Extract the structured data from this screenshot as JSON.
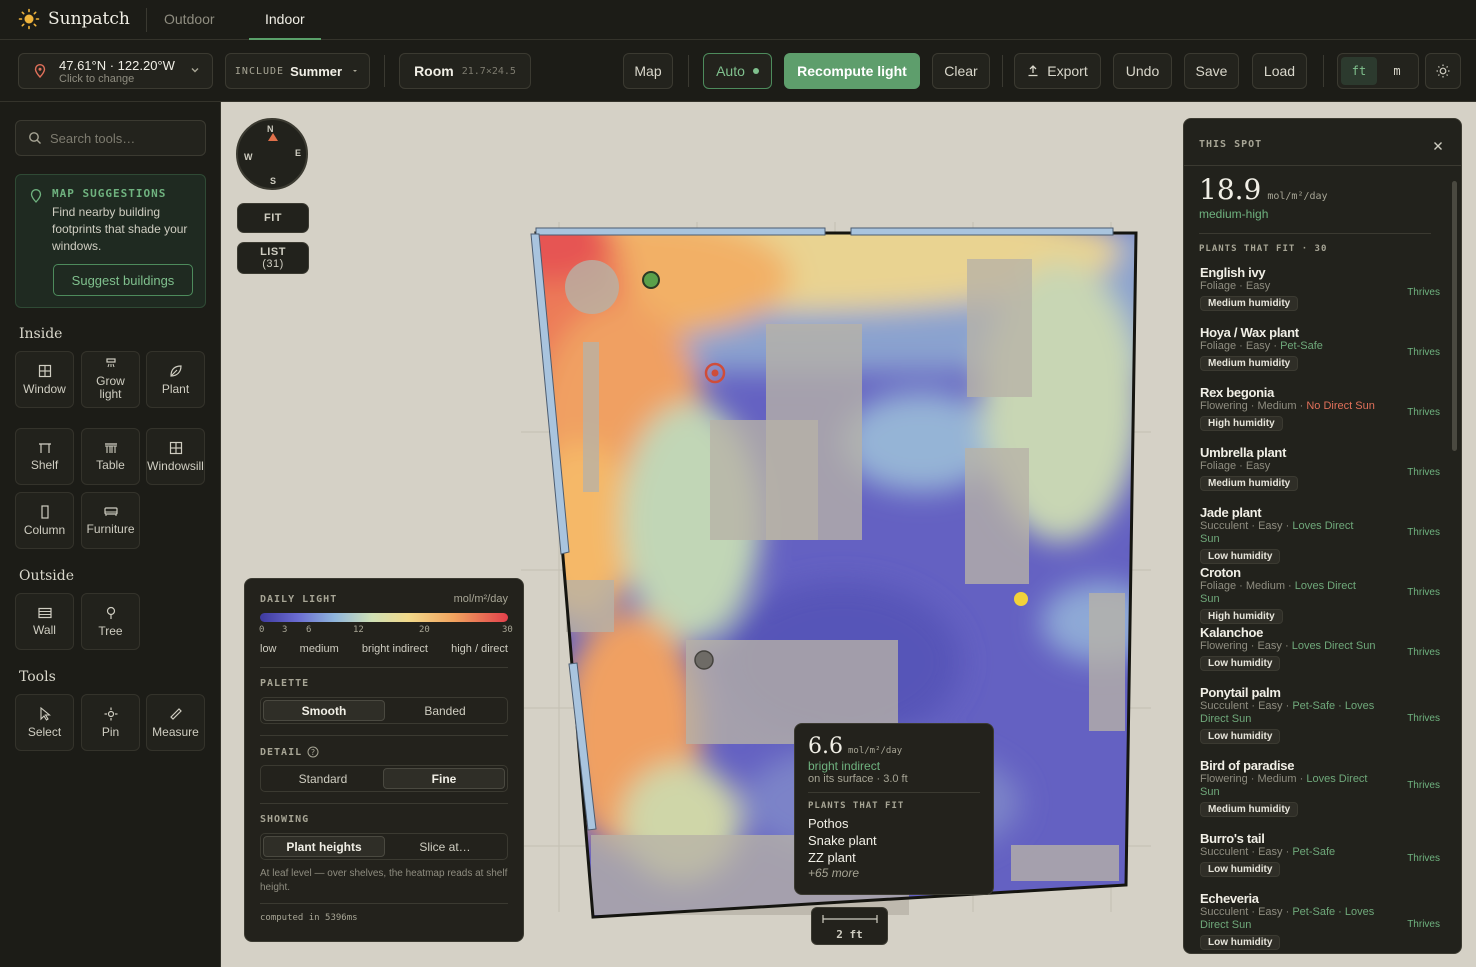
{
  "app": {
    "name": "Sunpatch"
  },
  "tabs": [
    {
      "label": "Outdoor"
    },
    {
      "label": "Indoor"
    }
  ],
  "toolbar": {
    "location_coords": "47.61°N · 122.20°W",
    "location_hint": "Click to change",
    "include_label": "INCLUDE",
    "season": "Summer",
    "room_label": "Room",
    "room_dims": "21.7×24.5",
    "map": "Map",
    "auto": "Auto",
    "recompute": "Recompute light",
    "clear": "Clear",
    "export": "Export",
    "undo": "Undo",
    "save": "Save",
    "load": "Load",
    "unit_ft": "ft",
    "unit_m": "m"
  },
  "sidebar": {
    "search_placeholder": "Search tools…",
    "suggest_title": "MAP SUGGESTIONS",
    "suggest_body": "Find nearby building footprints that shade your windows.",
    "suggest_button": "Suggest buildings",
    "sections": {
      "inside": "Inside",
      "outside": "Outside",
      "tools": "Tools"
    },
    "inside_tools": [
      {
        "label": "Window",
        "icon": "window-icon"
      },
      {
        "label": "Grow light",
        "icon": "grow-light-icon"
      },
      {
        "label": "Plant",
        "icon": "leaf-icon"
      },
      {
        "label": "Shelf",
        "icon": "shelf-icon"
      },
      {
        "label": "Table",
        "icon": "table-icon"
      },
      {
        "label": "Windowsill",
        "icon": "windowsill-icon"
      },
      {
        "label": "Column",
        "icon": "column-icon"
      },
      {
        "label": "Furniture",
        "icon": "sofa-icon"
      }
    ],
    "outside_tools": [
      {
        "label": "Wall",
        "icon": "wall-icon"
      },
      {
        "label": "Tree",
        "icon": "tree-icon"
      }
    ],
    "tools": [
      {
        "label": "Select",
        "icon": "cursor-icon"
      },
      {
        "label": "Pin",
        "icon": "pin-icon"
      },
      {
        "label": "Measure",
        "icon": "ruler-icon"
      }
    ]
  },
  "canvas": {
    "compass": {
      "n": "N",
      "e": "E",
      "s": "S",
      "w": "W"
    },
    "fit": "FIT",
    "list": "LIST",
    "list_count": "(31)"
  },
  "legend": {
    "title": "DAILY LIGHT",
    "unit": "mol/m²/day",
    "ticks": [
      "0",
      "3",
      "6",
      "12",
      "20",
      "30"
    ],
    "bands": [
      "low",
      "medium",
      "bright indirect",
      "high / direct"
    ],
    "palette_title": "PALETTE",
    "palette_options": [
      "Smooth",
      "Banded"
    ],
    "palette_selected": "Smooth",
    "detail_title": "DETAIL",
    "detail_options": [
      "Standard",
      "Fine"
    ],
    "detail_selected": "Fine",
    "showing_title": "SHOWING",
    "showing_options": [
      "Plant heights",
      "Slice at…"
    ],
    "showing_selected": "Plant heights",
    "showing_note": "At leaf level — over shelves, the heatmap reads at shelf height.",
    "computed": "computed in 5396ms"
  },
  "tooltip": {
    "value": "6.6",
    "unit": "mol/m²/day",
    "band": "bright indirect",
    "surface": "on its surface · 3.0 ft",
    "plants_title": "PLANTS THAT FIT",
    "plants": [
      "Pothos",
      "Snake plant",
      "ZZ plant"
    ],
    "more": "+65 more"
  },
  "scale": {
    "label": "2 ft"
  },
  "spot": {
    "title": "THIS SPOT",
    "value": "18.9",
    "unit": "mol/m²/day",
    "band": "medium-high",
    "plants_title": "PLANTS THAT FIT · 30",
    "plants": [
      {
        "name": "English ivy",
        "meta": "Foliage · Easy",
        "tag": "",
        "tag_color": "",
        "humidity": "Medium humidity",
        "status": "Thrives"
      },
      {
        "name": "Hoya / Wax plant",
        "meta": "Foliage · Easy · ",
        "tag": "Pet-Safe",
        "tag_color": "#6fa87a",
        "humidity": "Medium humidity",
        "status": "Thrives"
      },
      {
        "name": "Rex begonia",
        "meta": "Flowering · Medium · ",
        "tag": "No Direct Sun",
        "tag_color": "#e0705a",
        "humidity": "High humidity",
        "status": "Thrives"
      },
      {
        "name": "Umbrella plant",
        "meta": "Foliage · Easy",
        "tag": "",
        "tag_color": "",
        "humidity": "Medium humidity",
        "status": "Thrives"
      },
      {
        "name": "Jade plant",
        "meta": "Succulent · Easy · ",
        "tag": "Loves Direct Sun",
        "tag_color": "#6fa87a",
        "humidity": "Low humidity",
        "status": "Thrives"
      },
      {
        "name": "Croton",
        "meta": "Foliage · Medium · ",
        "tag": "Loves Direct Sun",
        "tag_color": "#6fa87a",
        "humidity": "High humidity",
        "status": "Thrives"
      },
      {
        "name": "Kalanchoe",
        "meta": "Flowering · Easy · ",
        "tag": "Loves Direct Sun",
        "tag_color": "#6fa87a",
        "humidity": "Low humidity",
        "status": "Thrives"
      },
      {
        "name": "Ponytail palm",
        "meta": "Succulent · Easy · ",
        "tag": "Pet-Safe · Loves Direct Sun",
        "tag_color": "#6fa87a",
        "humidity": "Low humidity",
        "status": "Thrives"
      },
      {
        "name": "Bird of paradise",
        "meta": "Flowering · Medium · ",
        "tag": "Loves Direct Sun",
        "tag_color": "#6fa87a",
        "humidity": "Medium humidity",
        "status": "Thrives"
      },
      {
        "name": "Burro's tail",
        "meta": "Succulent · Easy · ",
        "tag": "Pet-Safe",
        "tag_color": "#6fa87a",
        "humidity": "Low humidity",
        "status": "Thrives"
      },
      {
        "name": "Echeveria",
        "meta": "Succulent · Easy · ",
        "tag": "Pet-Safe · Loves Direct Sun",
        "tag_color": "#6fa87a",
        "humidity": "Low humidity",
        "status": "Thrives"
      }
    ]
  }
}
